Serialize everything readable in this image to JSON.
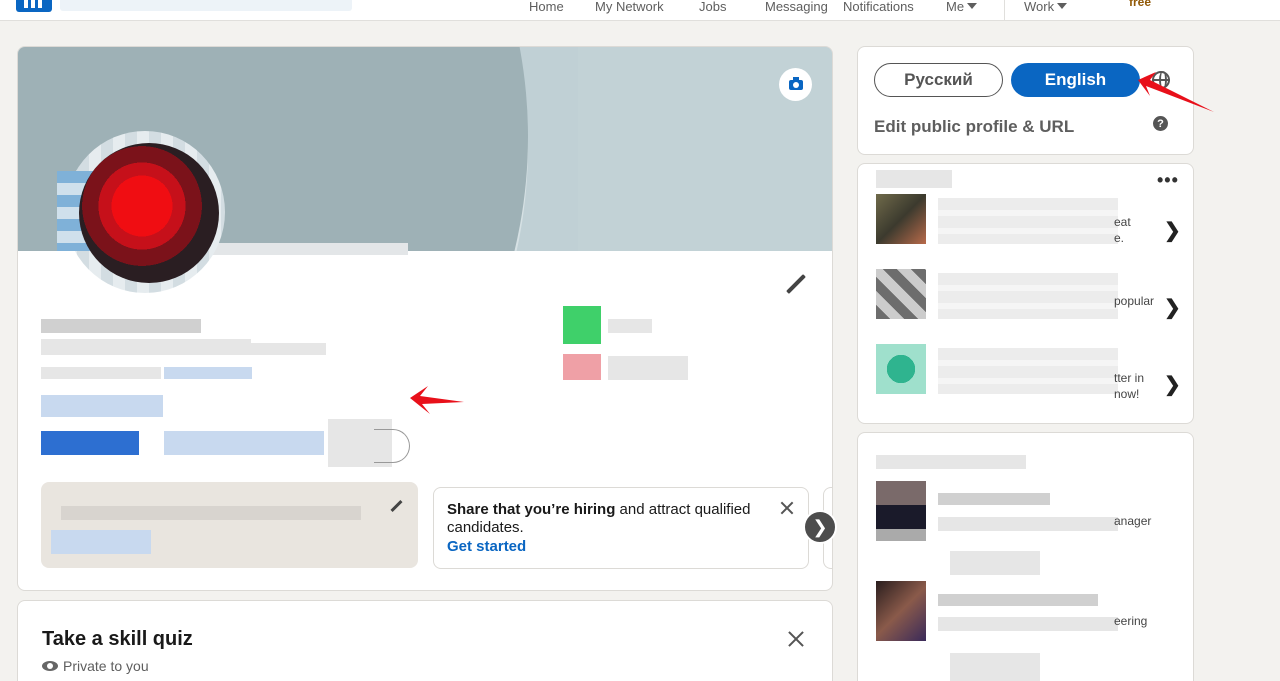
{
  "nav": {
    "items": [
      "Home",
      "My Network",
      "Jobs",
      "Messaging",
      "Notifications",
      "Me",
      "Work"
    ],
    "premium": "free"
  },
  "hiring": {
    "bold_text": "Share that you’re hiring",
    "rest_text": " and attract qualified candidates.",
    "link": "Get started",
    "next_glyph": "❯"
  },
  "quiz": {
    "title": "Take a skill quiz",
    "private": "Private to you"
  },
  "language": {
    "russian": "Русский",
    "english": "English",
    "edit_public": "Edit public profile & URL",
    "help": "?"
  },
  "ads": {
    "more": "•••",
    "items": [
      {
        "frag1": "eat",
        "frag2": "e.",
        "chevron": "❯"
      },
      {
        "frag1": "popular",
        "frag2": "",
        "chevron": "❯"
      },
      {
        "frag1": "tter in",
        "frag2": "now!",
        "chevron": "❯"
      }
    ]
  },
  "people": {
    "items": [
      {
        "frag": "anager"
      },
      {
        "frag": "eering"
      }
    ]
  },
  "colors": {
    "brand": "#0a66c2",
    "annotation_arrow": "#e8101a"
  }
}
